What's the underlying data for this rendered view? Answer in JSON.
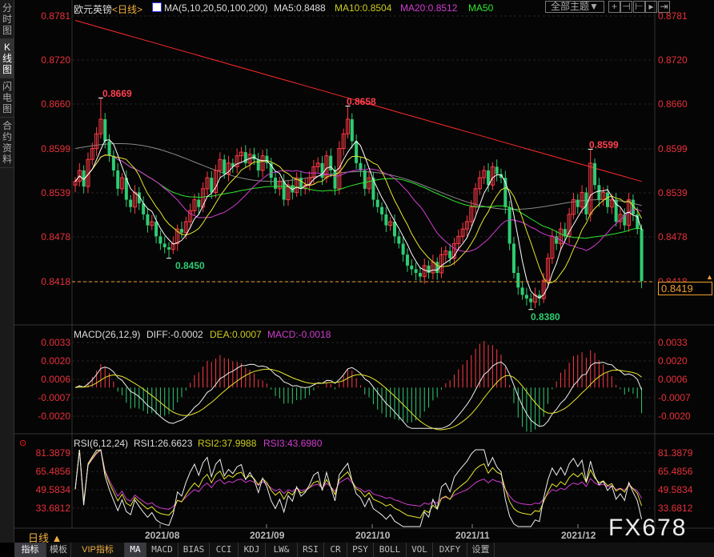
{
  "sidebar": {
    "tabs": [
      {
        "label": "分时图"
      },
      {
        "label": "K线图"
      },
      {
        "label": "闪电图"
      },
      {
        "label": "合约资料"
      }
    ]
  },
  "header": {
    "symbol": "欧元英镑",
    "period": "<日线>",
    "ma_label": "MA(5,10,20,50,100,200)",
    "ma5": "MA5:0.8488",
    "ma10": "MA10:0.8504",
    "ma20": "MA20:0.8512",
    "ma50": "MA50",
    "theme_button": "全部主题▼"
  },
  "main_axis": {
    "ticks": [
      "0.8781",
      "0.8720",
      "0.8660",
      "0.8599",
      "0.8539",
      "0.8478",
      "0.8418"
    ],
    "current_price": "0.8419"
  },
  "annotations": {
    "high1": "0.8669",
    "low1": "0.8450",
    "high2": "0.8658",
    "low2": "0.8380",
    "high3": "0.8599"
  },
  "macd": {
    "label": "MACD(26,12,9)",
    "diff": "DIFF:-0.0002",
    "dea": "DEA:0.0007",
    "macd": "MACD:-0.0018",
    "ticks": [
      "0.0033",
      "0.0020",
      "0.0006",
      "-0.0007",
      "-0.0020"
    ]
  },
  "rsi": {
    "label": "RSI(6,12,24)",
    "rsi1": "RSI1:26.6623",
    "rsi2": "RSI2:37.9988",
    "rsi3": "RSI3:43.6980",
    "ticks": [
      "81.3879",
      "65.4856",
      "49.5834",
      "33.6812"
    ]
  },
  "dates": [
    "2021/08",
    "2021/09",
    "2021/10",
    "2021/11",
    "2021/12"
  ],
  "period_selector": "日线 ▲",
  "watermark": "FX678",
  "toolbar": [
    "指标",
    "模板",
    "VIP指标",
    "MA",
    "MACD",
    "BIAS",
    "CCI",
    "KDJ",
    "LW&",
    "RSI",
    "CR",
    "PSY",
    "BOLL",
    "VOL",
    "DXFY",
    "设置"
  ],
  "colors": {
    "up": "#ff3a44",
    "down": "#2ecc71",
    "ma5": "#ffffff",
    "ma10": "#e6e62e",
    "ma20": "#d23cd2",
    "ma50": "#2ee62e",
    "ma100": "#888888",
    "ma200": "#ff2a2a"
  },
  "chart_data": {
    "type": "candlestick",
    "closes": [
      0.8555,
      0.857,
      0.8548,
      0.8585,
      0.86,
      0.862,
      0.864,
      0.861,
      0.859,
      0.857,
      0.8545,
      0.856,
      0.853,
      0.852,
      0.854,
      0.8525,
      0.851,
      0.8495,
      0.85,
      0.848,
      0.847,
      0.8465,
      0.8462,
      0.847,
      0.849,
      0.8485,
      0.85,
      0.8515,
      0.853,
      0.852,
      0.8545,
      0.856,
      0.854,
      0.857,
      0.8585,
      0.8565,
      0.858,
      0.8575,
      0.859,
      0.8595,
      0.858,
      0.8592,
      0.8585,
      0.857,
      0.859,
      0.858,
      0.856,
      0.8545,
      0.8555,
      0.853,
      0.855,
      0.854,
      0.856,
      0.8545,
      0.855,
      0.856,
      0.8575,
      0.858,
      0.856,
      0.859,
      0.857,
      0.8545,
      0.86,
      0.862,
      0.864,
      0.861,
      0.858,
      0.857,
      0.8545,
      0.856,
      0.853,
      0.852,
      0.851,
      0.8495,
      0.85,
      0.848,
      0.847,
      0.8455,
      0.844,
      0.8435,
      0.843,
      0.8425,
      0.844,
      0.843,
      0.8445,
      0.843,
      0.8455,
      0.846,
      0.845,
      0.847,
      0.848,
      0.849,
      0.85,
      0.852,
      0.8545,
      0.856,
      0.857,
      0.855,
      0.8575,
      0.8565,
      0.856,
      0.852,
      0.847,
      0.843,
      0.841,
      0.84,
      0.8395,
      0.839,
      0.84,
      0.8395,
      0.842,
      0.845,
      0.848,
      0.847,
      0.849,
      0.848,
      0.851,
      0.853,
      0.852,
      0.854,
      0.851,
      0.858,
      0.855,
      0.853,
      0.854,
      0.852,
      0.853,
      0.85,
      0.851,
      0.8495,
      0.853,
      0.851,
      0.849,
      0.8419
    ],
    "extremes": [
      {
        "index": 6,
        "high": 0.8669
      },
      {
        "index": 22,
        "low": 0.845
      },
      {
        "index": 64,
        "high": 0.8658
      },
      {
        "index": 107,
        "low": 0.838
      },
      {
        "index": 121,
        "high": 0.8599
      }
    ],
    "ma100_range": [
      0.86,
      0.851
    ],
    "ma200_range": [
      0.8775,
      0.8555
    ],
    "ylim": [
      0.837,
      0.88
    ],
    "macd_ylim": [
      -0.0028,
      0.0038
    ],
    "rsi_ylim": [
      15,
      95
    ]
  }
}
